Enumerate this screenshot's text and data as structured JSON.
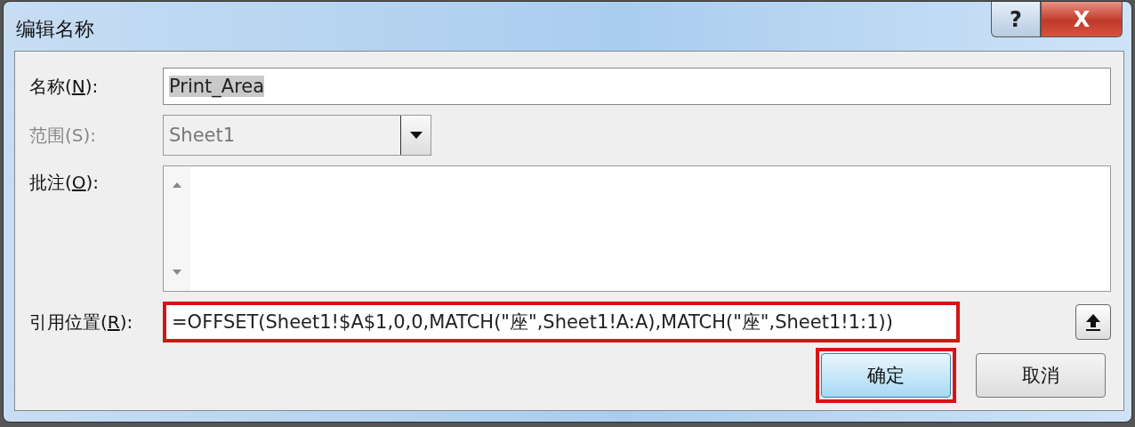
{
  "window": {
    "title": "编辑名称",
    "help_button": "?",
    "close_button": "X"
  },
  "fields": [
    {
      "kind": "text",
      "label": {
        "before": "名称(",
        "key": "N",
        "after": "):"
      },
      "disabled": false,
      "value": "Print_Area",
      "selected_text": true
    },
    {
      "kind": "dropdown",
      "label": {
        "before": "范围(S):"
      },
      "disabled": true,
      "value": "Sheet1"
    },
    {
      "kind": "multiline",
      "label": {
        "before": "批注(",
        "key": "O",
        "after": "):"
      },
      "disabled": false
    },
    {
      "kind": "reference",
      "label": {
        "before": "引用位置(",
        "key": "R",
        "after": "):"
      },
      "disabled": false,
      "value": "=OFFSET(Sheet1!$A$1,0,0,MATCH(\"座\",Sheet1!A:A),MATCH(\"座\",Sheet1!1:1))",
      "highlighted": true
    }
  ],
  "buttons": [
    {
      "label": "确定",
      "default": true,
      "highlighted": true
    },
    {
      "label": "取消",
      "default": false,
      "highlighted": false
    }
  ]
}
